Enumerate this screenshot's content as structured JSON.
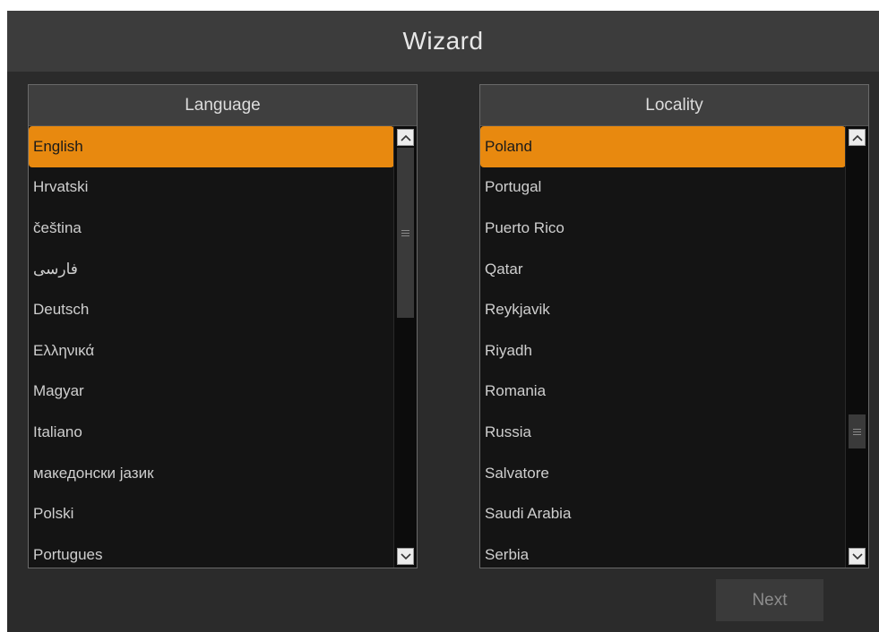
{
  "window": {
    "title": "Wizard"
  },
  "language": {
    "header": "Language",
    "selected_index": 0,
    "items": [
      "English",
      "Hrvatski",
      "čeština",
      "فارسی",
      "Deutsch",
      "Ελληνικά",
      "Magyar",
      "Italiano",
      "македонски јазик",
      "Polski",
      "Portugues"
    ]
  },
  "locality": {
    "header": "Locality",
    "selected_index": 0,
    "items": [
      "Poland",
      "Portugal",
      "Puerto Rico",
      "Qatar",
      "Reykjavik",
      "Riyadh",
      "Romania",
      "Russia",
      "Salvatore",
      "Saudi Arabia",
      "Serbia"
    ]
  },
  "buttons": {
    "next": "Next"
  },
  "icons": {
    "scroll_up": "chevron-up-icon",
    "scroll_down": "chevron-down-icon",
    "scroll_grip": "grip-icon"
  },
  "colors": {
    "selection": "#e8890f",
    "background": "#2b2b2b",
    "titlebar": "#3c3c3c"
  }
}
